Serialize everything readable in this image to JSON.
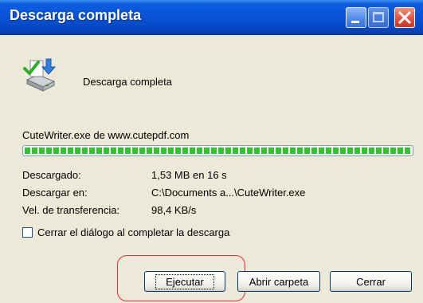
{
  "window": {
    "title": "Descarga completa"
  },
  "header": {
    "text": "Descarga completa"
  },
  "file_line": "CuteWriter.exe de www.cutepdf.com",
  "progress": {
    "fraction": 1.0
  },
  "details": [
    {
      "label": "Descargado:",
      "value": "1,53 MB en 16 s"
    },
    {
      "label": "Descargar en:",
      "value": "C:\\Documents a...\\CuteWriter.exe"
    },
    {
      "label": "Vel. de transferencia:",
      "value": "98,4 KB/s"
    }
  ],
  "checkbox": {
    "label": "Cerrar el diálogo al completar la descarga",
    "checked": false
  },
  "buttons": {
    "run": "Ejecutar",
    "open_folder": "Abrir carpeta",
    "close": "Cerrar"
  },
  "colors": {
    "titlebar": "#0853d6",
    "progress": "#2fc432",
    "highlight": "#e03030"
  },
  "icons": {
    "download": "download-complete-icon"
  }
}
